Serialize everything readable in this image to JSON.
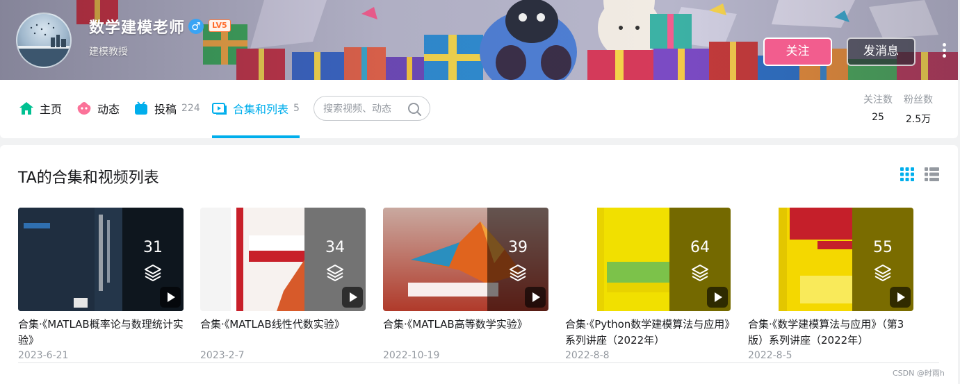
{
  "user": {
    "name": "数学建模老师",
    "gender_icon": "♂",
    "level": "LV5",
    "sign": "建模教授"
  },
  "actions": {
    "follow_label": "关注",
    "message_label": "发消息"
  },
  "nav": {
    "items": [
      {
        "label": "主页",
        "icon": "home-icon"
      },
      {
        "label": "动态",
        "icon": "dynamic-icon"
      },
      {
        "label": "投稿",
        "icon": "upload-icon",
        "count": "224"
      },
      {
        "label": "合集和列表",
        "icon": "collection-icon",
        "count": "5",
        "active": true
      }
    ],
    "search_placeholder": "搜索视频、动态"
  },
  "stats": {
    "following_label": "关注数",
    "following_value": "25",
    "fans_label": "粉丝数",
    "fans_value": "2.5万"
  },
  "section": {
    "title": "TA的合集和视频列表"
  },
  "collections": [
    {
      "count": "31",
      "title": "合集·《MATLAB概率论与数理统计实验》",
      "date": "2023-6-21"
    },
    {
      "count": "34",
      "title": "合集·《MATLAB线性代数实验》",
      "date": "2023-2-7"
    },
    {
      "count": "39",
      "title": "合集·《MATLAB高等数学实验》",
      "date": "2022-10-19"
    },
    {
      "count": "64",
      "title": "合集·《Python数学建模算法与应用》系列讲座（2022年）",
      "date": "2022-8-8"
    },
    {
      "count": "55",
      "title": "合集·《数学建模算法与应用》（第3版）系列讲座（2022年）",
      "date": "2022-8-5"
    }
  ],
  "watermark": "CSDN @时雨h",
  "colors": {
    "accent": "#00aeec",
    "follow": "#f25d8e",
    "muted": "#9499a0"
  }
}
